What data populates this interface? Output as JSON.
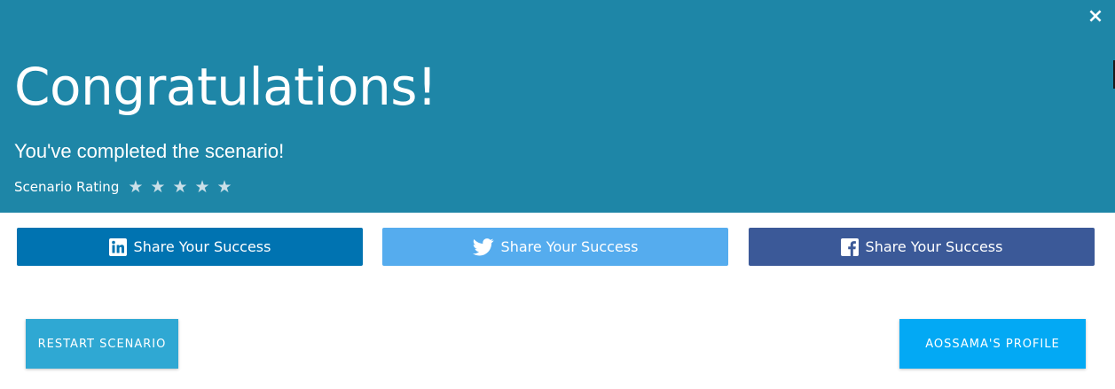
{
  "header": {
    "title": "Congratulations!",
    "subtitle": "You've completed the scenario!",
    "rating_label": "Scenario Rating",
    "stars": 5,
    "background": "#1e86a7"
  },
  "close": {
    "icon": "close-icon",
    "glyph": "×"
  },
  "share": {
    "linkedin": {
      "label": "Share Your Success",
      "icon": "linkedin-icon",
      "color": "#0073b1"
    },
    "twitter": {
      "label": "Share Your Success",
      "icon": "twitter-icon",
      "color": "#55acee"
    },
    "facebook": {
      "label": "Share Your Success",
      "icon": "facebook-icon",
      "color": "#3b5998"
    }
  },
  "actions": {
    "restart_label": "RESTART SCENARIO",
    "profile_label": "AOSSAMA'S PROFILE"
  }
}
